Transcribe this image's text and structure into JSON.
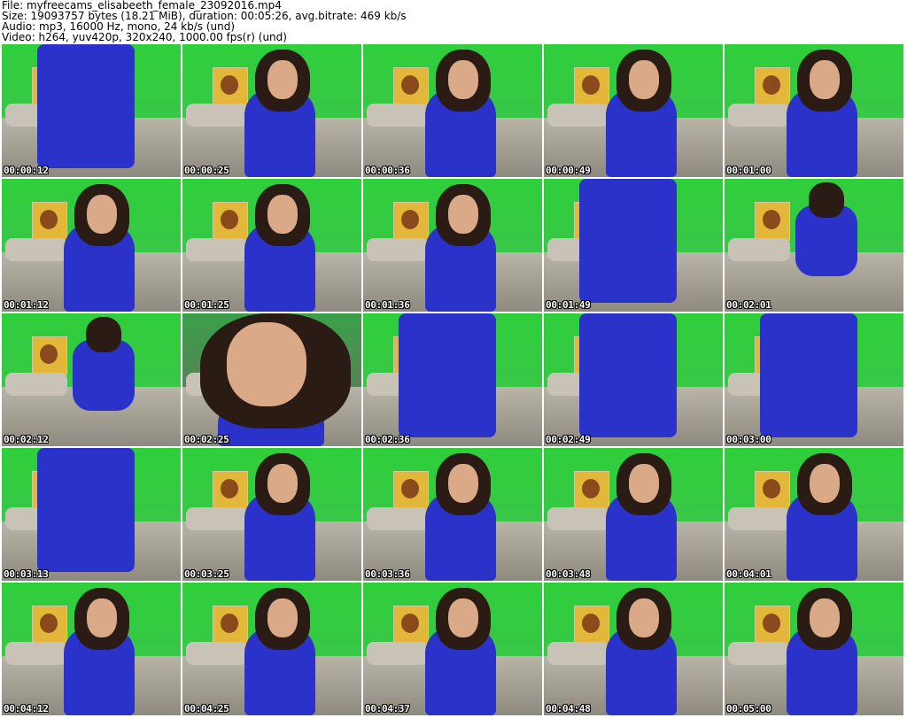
{
  "header": {
    "file": "File: myfreecams_elisabeeth_female_23092016.mp4",
    "size": "Size: 19093757 bytes (18.21 MiB), duration: 00:05:26, avg.bitrate: 469 kb/s",
    "audio": "Audio: mp3, 16000 Hz, mono, 24 kb/s (und)",
    "video": "Video: h264, yuv420p, 320x240, 1000.00 fps(r) (und)"
  },
  "thumbnails": [
    {
      "time": "00:00:12",
      "variant": "standing"
    },
    {
      "time": "00:00:25",
      "variant": "seated"
    },
    {
      "time": "00:00:36",
      "variant": "seated"
    },
    {
      "time": "00:00:49",
      "variant": "seated"
    },
    {
      "time": "00:01:00",
      "variant": "seated"
    },
    {
      "time": "00:01:12",
      "variant": "seated"
    },
    {
      "time": "00:01:25",
      "variant": "seated"
    },
    {
      "time": "00:01:36",
      "variant": "seated"
    },
    {
      "time": "00:01:49",
      "variant": "standing"
    },
    {
      "time": "00:02:01",
      "variant": "kneel"
    },
    {
      "time": "00:02:12",
      "variant": "kneel"
    },
    {
      "time": "00:02:25",
      "variant": "close"
    },
    {
      "time": "00:02:36",
      "variant": "standing"
    },
    {
      "time": "00:02:49",
      "variant": "standing"
    },
    {
      "time": "00:03:00",
      "variant": "standing"
    },
    {
      "time": "00:03:13",
      "variant": "standing"
    },
    {
      "time": "00:03:25",
      "variant": "seated"
    },
    {
      "time": "00:03:36",
      "variant": "seated"
    },
    {
      "time": "00:03:48",
      "variant": "seated"
    },
    {
      "time": "00:04:01",
      "variant": "seated"
    },
    {
      "time": "00:04:12",
      "variant": "seated"
    },
    {
      "time": "00:04:25",
      "variant": "seated"
    },
    {
      "time": "00:04:37",
      "variant": "seated"
    },
    {
      "time": "00:04:48",
      "variant": "seated"
    },
    {
      "time": "00:05:00",
      "variant": "seated"
    }
  ]
}
